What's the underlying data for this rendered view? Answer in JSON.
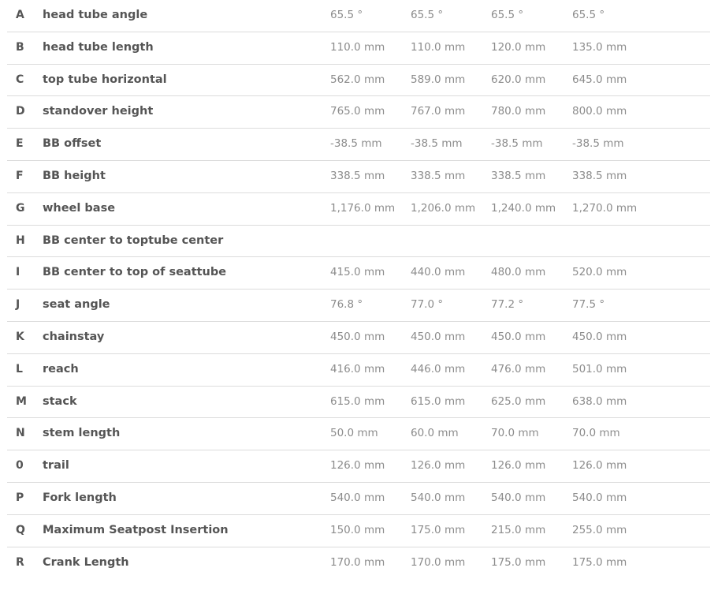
{
  "rows": [
    {
      "letter": "A",
      "label": "head tube angle",
      "values": [
        "65.5 °",
        "65.5 °",
        "65.5 °",
        "65.5 °"
      ]
    },
    {
      "letter": "B",
      "label": "head tube length",
      "values": [
        "110.0 mm",
        "110.0 mm",
        "120.0 mm",
        "135.0 mm"
      ]
    },
    {
      "letter": "C",
      "label": "top tube horizontal",
      "values": [
        "562.0 mm",
        "589.0 mm",
        "620.0 mm",
        "645.0 mm"
      ]
    },
    {
      "letter": "D",
      "label": "standover height",
      "values": [
        "765.0 mm",
        "767.0 mm",
        "780.0 mm",
        "800.0 mm"
      ]
    },
    {
      "letter": "E",
      "label": "BB offset",
      "values": [
        "-38.5 mm",
        "-38.5 mm",
        "-38.5 mm",
        "-38.5 mm"
      ]
    },
    {
      "letter": "F",
      "label": "BB height",
      "values": [
        "338.5 mm",
        "338.5 mm",
        "338.5 mm",
        "338.5 mm"
      ]
    },
    {
      "letter": "G",
      "label": "wheel base",
      "values": [
        "1,176.0 mm",
        "1,206.0 mm",
        "1,240.0 mm",
        "1,270.0 mm"
      ]
    },
    {
      "letter": "H",
      "label": "BB center to toptube center",
      "values": [
        "",
        "",
        "",
        ""
      ]
    },
    {
      "letter": "I",
      "label": "BB center to top of seattube",
      "values": [
        "415.0 mm",
        "440.0 mm",
        "480.0 mm",
        "520.0 mm"
      ]
    },
    {
      "letter": "J",
      "label": "seat angle",
      "values": [
        "76.8 °",
        "77.0 °",
        "77.2 °",
        "77.5 °"
      ]
    },
    {
      "letter": "K",
      "label": "chainstay",
      "values": [
        "450.0 mm",
        "450.0 mm",
        "450.0 mm",
        "450.0 mm"
      ]
    },
    {
      "letter": "L",
      "label": "reach",
      "values": [
        "416.0 mm",
        "446.0 mm",
        "476.0 mm",
        "501.0 mm"
      ]
    },
    {
      "letter": "M",
      "label": "stack",
      "values": [
        "615.0 mm",
        "615.0 mm",
        "625.0 mm",
        "638.0 mm"
      ]
    },
    {
      "letter": "N",
      "label": "stem length",
      "values": [
        "50.0 mm",
        "60.0 mm",
        "70.0 mm",
        "70.0 mm"
      ]
    },
    {
      "letter": "0",
      "label": "trail",
      "values": [
        "126.0 mm",
        "126.0 mm",
        "126.0 mm",
        "126.0 mm"
      ]
    },
    {
      "letter": "P",
      "label": "Fork length",
      "values": [
        "540.0 mm",
        "540.0 mm",
        "540.0 mm",
        "540.0 mm"
      ]
    },
    {
      "letter": "Q",
      "label": "Maximum Seatpost Insertion",
      "values": [
        "150.0 mm",
        "175.0 mm",
        "215.0 mm",
        "255.0 mm"
      ]
    },
    {
      "letter": "R",
      "label": "Crank Length",
      "values": [
        "170.0 mm",
        "170.0 mm",
        "175.0 mm",
        "175.0 mm"
      ]
    }
  ]
}
